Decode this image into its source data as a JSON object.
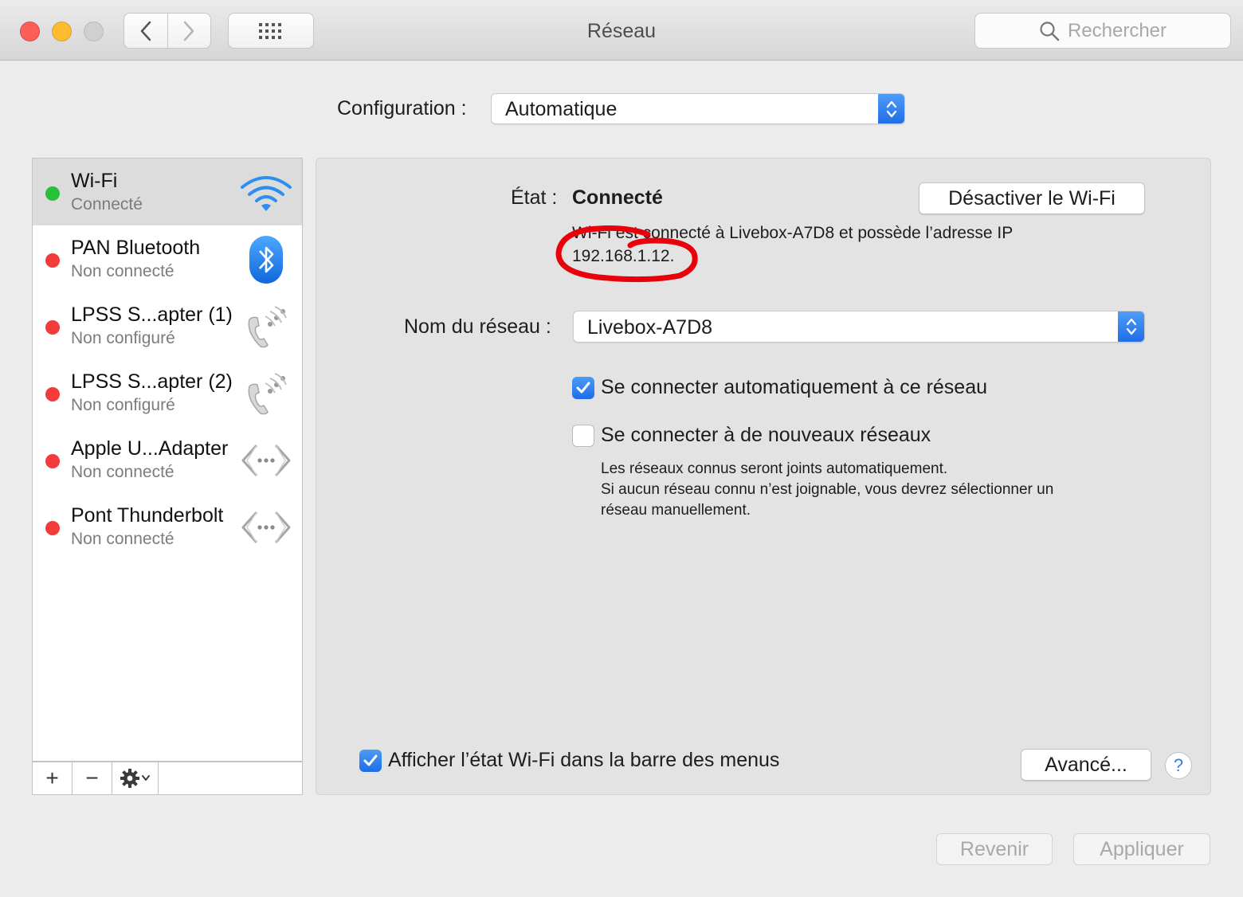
{
  "window": {
    "title": "Réseau",
    "search_placeholder": "Rechercher"
  },
  "configuration": {
    "label": "Configuration :",
    "value": "Automatique"
  },
  "services": [
    {
      "name": "Wi-Fi",
      "status": "Connecté",
      "dot": "green",
      "icon": "wifi-icon",
      "selected": true
    },
    {
      "name": "PAN Bluetooth",
      "status": "Non connecté",
      "dot": "red",
      "icon": "bluetooth-icon"
    },
    {
      "name": "LPSS S...apter (1)",
      "status": "Non configuré",
      "dot": "red",
      "icon": "phone-icon"
    },
    {
      "name": "LPSS S...apter (2)",
      "status": "Non configuré",
      "dot": "red",
      "icon": "phone-icon"
    },
    {
      "name": "Apple U...Adapter",
      "status": "Non connecté",
      "dot": "red",
      "icon": "ethernet-icon"
    },
    {
      "name": "Pont Thunderbolt",
      "status": "Non connecté",
      "dot": "red",
      "icon": "ethernet-icon"
    }
  ],
  "sidebar_toolbar": {
    "add": "+",
    "remove": "−"
  },
  "status": {
    "label": "État :",
    "value": "Connecté",
    "toggle_button": "Désactiver le Wi-Fi",
    "description_line1": "Wi-Fi est connecté à Livebox-A7D8 et possède l’adresse IP",
    "description_line2": "192.168.1.12."
  },
  "network": {
    "label": "Nom du réseau :",
    "value": "Livebox-A7D8"
  },
  "options": {
    "auto_join": {
      "label": "Se connecter automatiquement à ce réseau",
      "checked": true
    },
    "ask_new": {
      "label": "Se connecter à de nouveaux réseaux",
      "checked": false
    },
    "help_line1": "Les réseaux connus seront joints automatiquement.",
    "help_line2": "Si aucun réseau connu n’est joignable, vous devrez sélectionner un",
    "help_line3": "réseau manuellement."
  },
  "menubar_option": {
    "label": "Afficher l’état Wi-Fi dans la barre des menus",
    "checked": true
  },
  "buttons": {
    "advanced": "Avancé...",
    "help": "?",
    "revert": "Revenir",
    "apply": "Appliquer"
  },
  "colors": {
    "accent": "#1f6ee8",
    "connected": "#27c03a",
    "disconnected": "#f23b3b",
    "annotation": "#e8000b"
  }
}
